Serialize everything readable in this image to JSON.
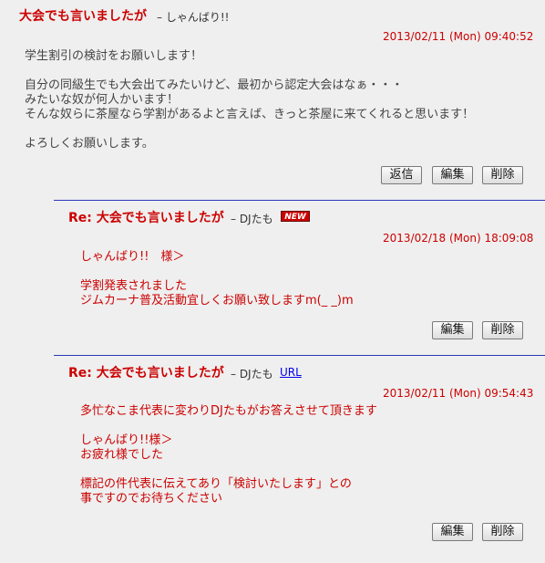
{
  "post1": {
    "title": "大会でも言いましたが",
    "author": "– しゃんばり!!",
    "date": "2013/02/11 (Mon) 09:40:52",
    "body": "学生割引の検討をお願いします！\n\n自分の同級生でも大会出てみたいけど、最初から認定大会はなぁ・・・\nみたいな奴が何人かいます！\nそんな奴らに茶屋なら学割があるよと言えば、きっと茶屋に来てくれると思います！\n\nよろしくお願いします。",
    "buttons": {
      "reply": "返信",
      "edit": "編集",
      "delete": "削除"
    }
  },
  "post2": {
    "title": "Re: 大会でも言いましたが",
    "author": "– DJたも",
    "badge": "NEW",
    "date": "2013/02/18 (Mon) 18:09:08",
    "body": "しゃんばり!!　様＞\n\n学割発表されました\nジムカーナ普及活動宜しくお願い致しますm(_ _)m",
    "buttons": {
      "edit": "編集",
      "delete": "削除"
    }
  },
  "post3": {
    "title": "Re: 大会でも言いましたが",
    "author": "– DJたも",
    "url_label": "URL",
    "date": "2013/02/11 (Mon) 09:54:43",
    "body": "多忙なこま代表に変わりDJたもがお答えさせて頂きます\n\nしゃんばり!!様＞\nお疲れ様でした\n\n標記の件代表に伝えてあり「検討いたします」との\n事ですのでお待ちください",
    "buttons": {
      "edit": "編集",
      "delete": "削除"
    }
  }
}
